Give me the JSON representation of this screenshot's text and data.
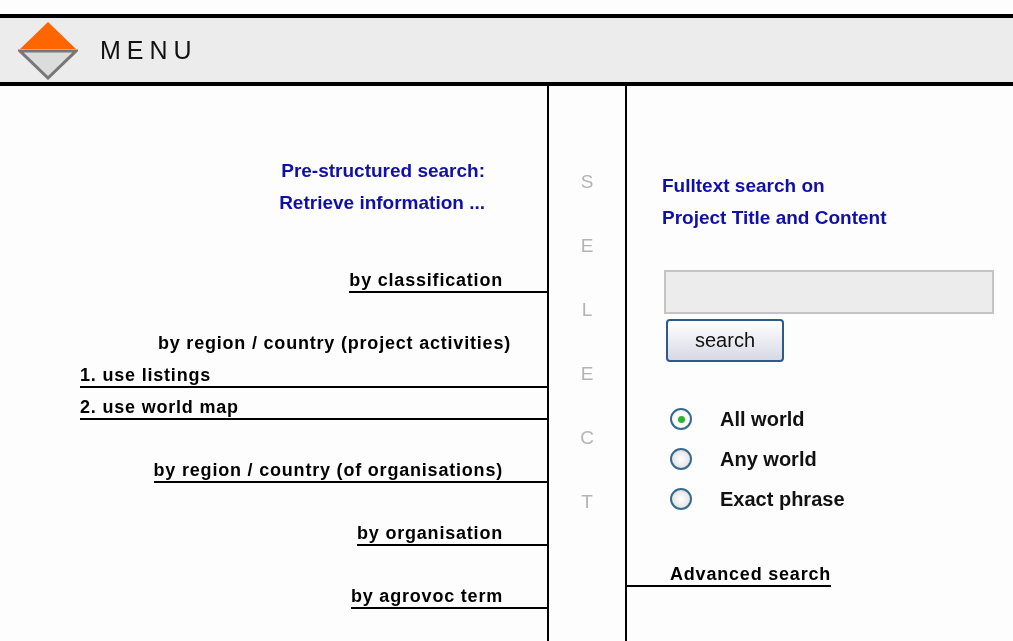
{
  "header": {
    "title": "MENU"
  },
  "left": {
    "heading": [
      "Pre-structured search:",
      "Retrieve information ..."
    ],
    "groups": [
      {
        "items": [
          {
            "kind": "link",
            "label": "by classification"
          }
        ]
      },
      {
        "items": [
          {
            "kind": "heading",
            "label": "by region / country (project activities)"
          },
          {
            "kind": "sub-link",
            "label": "1. use listings"
          },
          {
            "kind": "sub-link",
            "label": "2. use world map"
          }
        ]
      },
      {
        "items": [
          {
            "kind": "link",
            "label": "by region / country (of organisations)"
          }
        ]
      },
      {
        "items": [
          {
            "kind": "link",
            "label": "by organisation"
          }
        ]
      },
      {
        "items": [
          {
            "kind": "link",
            "label": "by agrovoc term"
          }
        ]
      }
    ]
  },
  "select_letters": [
    "S",
    "E",
    "L",
    "E",
    "C",
    "T"
  ],
  "right": {
    "title": [
      "Fulltext search on",
      "Project Title and Content"
    ],
    "search_button": "search",
    "options": [
      {
        "label": "All world",
        "selected": true
      },
      {
        "label": "Any world",
        "selected": false
      },
      {
        "label": "Exact phrase",
        "selected": false
      }
    ],
    "advanced_link": "Advanced search"
  }
}
